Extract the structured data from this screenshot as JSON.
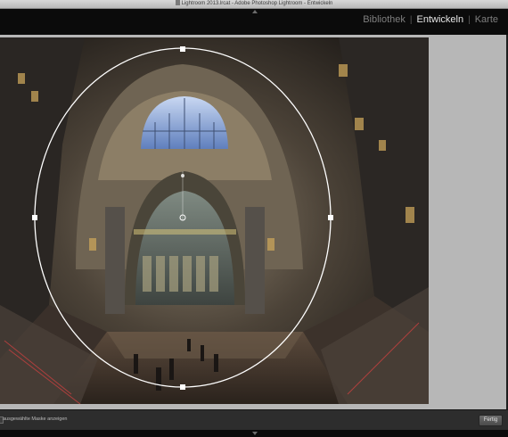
{
  "window": {
    "title": "Lightroom 2013.lrcat - Adobe Photoshop Lightroom - Entwickeln"
  },
  "modules": {
    "items": [
      {
        "label": "Bibliothek",
        "active": false
      },
      {
        "label": "Entwickeln",
        "active": true
      },
      {
        "label": "Karte",
        "active": false
      }
    ],
    "separator": "|"
  },
  "toolbar": {
    "show_mask_label": "ausgewählte Maske anzeigen",
    "done_button": "Fertig"
  },
  "icons": {
    "top_panel_toggle": "triangle-up-icon",
    "bottom_panel_toggle": "triangle-down-icon",
    "document": "document-icon"
  },
  "colors": {
    "module_active": "#e6e6e6",
    "module_inactive": "#7f7f7f",
    "topbar_bg": "#0b0b0b",
    "canvas_bg": "#b7b7b7",
    "mask_overlay": "#ffffff"
  }
}
